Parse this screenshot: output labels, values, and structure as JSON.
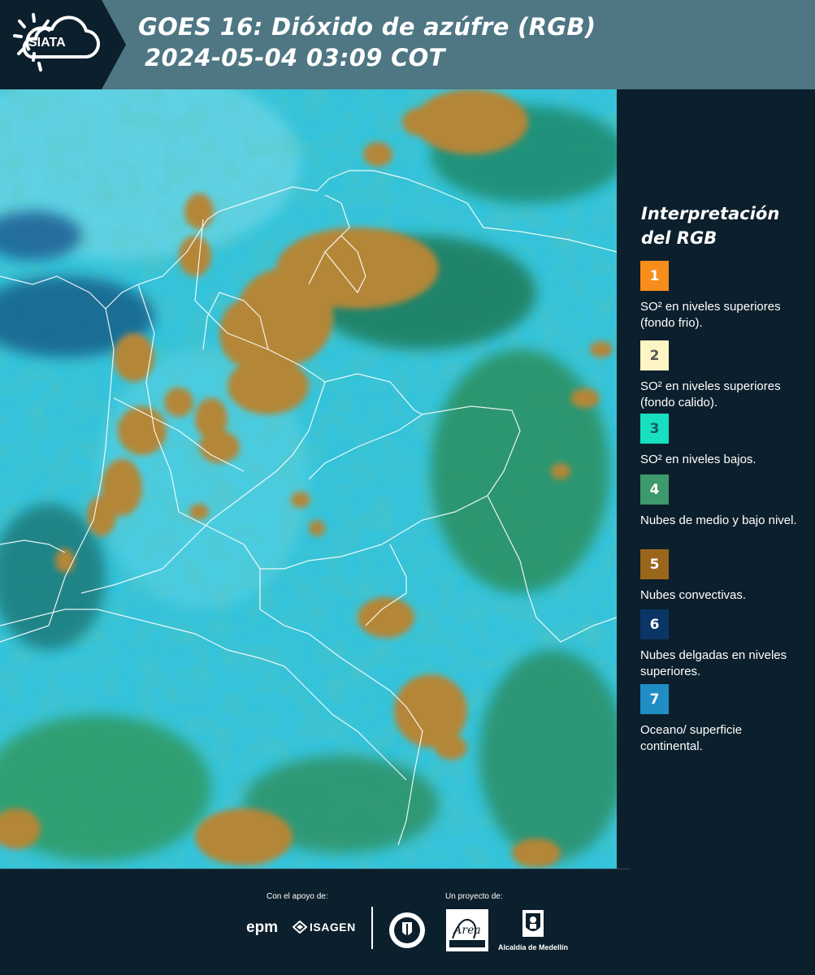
{
  "header": {
    "logo_text": "SIATA",
    "title_line1": "GOES 16: Dióxido de azúfre (RGB)",
    "title_line2": "2024-05-04 03:09 COT"
  },
  "map": {
    "map_type": "satellite-rgb-composite",
    "palette": {
      "cyan": "#2ec8d8",
      "teal": "#24a6a8",
      "green": "#2e8a5a",
      "dark_green": "#1f6e4e",
      "blue": "#1a6e9c",
      "orange": "#b58a3a",
      "boundary": "#ffffff"
    }
  },
  "legend": {
    "title": "Interpretación del RGB",
    "items": [
      {
        "number": "1",
        "color": "#f98d1b",
        "text_color": "#ffffff",
        "label": "SO² en niveles superiores (fondo frio)."
      },
      {
        "number": "2",
        "color": "#fdf6c3",
        "text_color": "#555555",
        "label": "SO² en niveles superiores (fondo calido)."
      },
      {
        "number": "3",
        "color": "#16e0c0",
        "text_color": "#1a5a66",
        "label": "SO² en niveles bajos."
      },
      {
        "number": "4",
        "color": "#3d9a6c",
        "text_color": "#ffffff",
        "label": "Nubes de medio y bajo nivel."
      },
      {
        "number": "5",
        "color": "#9a661c",
        "text_color": "#ffffff",
        "label": "Nubes convectivas."
      },
      {
        "number": "6",
        "color": "#0b3566",
        "text_color": "#ffffff",
        "label": "Nubes delgadas en niveles superiores."
      },
      {
        "number": "7",
        "color": "#1f8ec4",
        "text_color": "#ffffff",
        "label": "Oceano/ superficie continental."
      }
    ]
  },
  "footer": {
    "support_caption": "Con el apoyo de:",
    "project_caption": "Un proyecto de:",
    "sponsor_1": "epm",
    "sponsor_2": "ISAGEN",
    "partner_1": "Área Metropolitana Valle de Aburrá",
    "partner_2": "Alcaldía de Medellín"
  }
}
